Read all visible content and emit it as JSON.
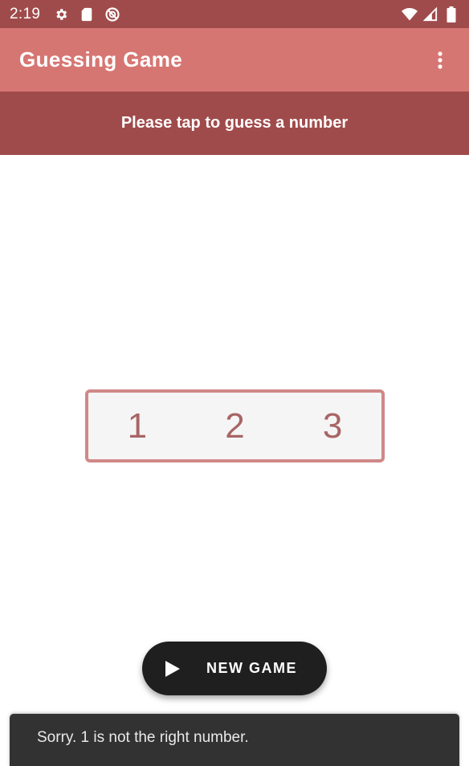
{
  "status_bar": {
    "time": "2:19",
    "left_icons": [
      "settings-icon",
      "sd-card-icon",
      "do-not-disturb-icon"
    ],
    "right_icons": [
      "wifi-icon",
      "cell-signal-icon",
      "battery-icon"
    ]
  },
  "app_bar": {
    "title": "Guessing Game",
    "overflow_icon": "more-vert-icon"
  },
  "prompt": {
    "text": "Please tap to guess a number"
  },
  "numbers": [
    "1",
    "2",
    "3"
  ],
  "fab": {
    "label": "NEW GAME",
    "icon": "play-icon"
  },
  "snackbar": {
    "message": "Sorry. 1 is not the right number."
  },
  "colors": {
    "primary_dark": "#a04b4b",
    "primary": "#d67673",
    "number_text": "#a86565",
    "box_border": "#d08888",
    "fab_bg": "#1f1f1f",
    "snackbar_bg": "#323232"
  }
}
